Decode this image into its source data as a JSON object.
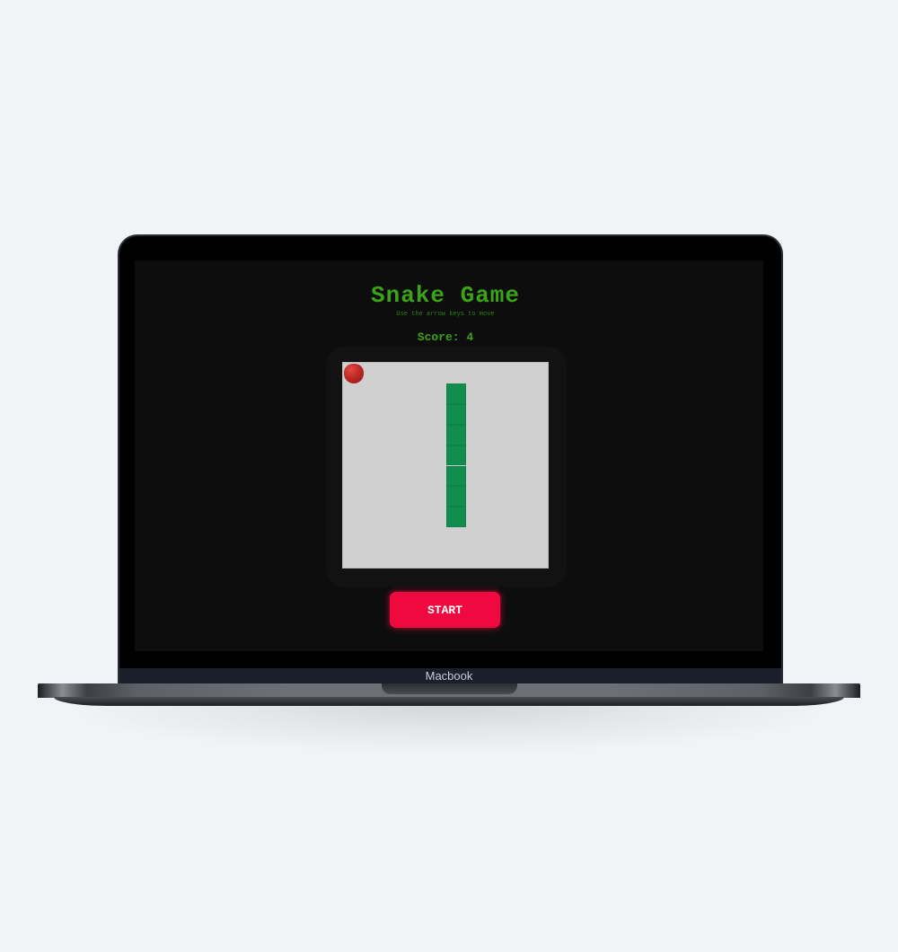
{
  "device": {
    "brand_label": "Macbook"
  },
  "game": {
    "title": "Snake Game",
    "subtitle": "Use the arrow keys to move",
    "score_text": "Score: 4",
    "start_label": "START",
    "grid_size": 10,
    "snake_cells": [
      [
        5,
        1
      ],
      [
        5,
        2
      ],
      [
        5,
        3
      ],
      [
        5,
        4
      ],
      [
        5,
        5
      ],
      [
        5,
        6
      ],
      [
        5,
        7
      ]
    ],
    "apple_cell": [
      0,
      0
    ]
  },
  "colors": {
    "title_green": "#3aa317",
    "snake_green": "#118d4e",
    "apple_red": "#c02a25",
    "start_button": "#f0093f",
    "board_bg": "#d0d0d0",
    "screen_bg": "#0d0d0d"
  }
}
